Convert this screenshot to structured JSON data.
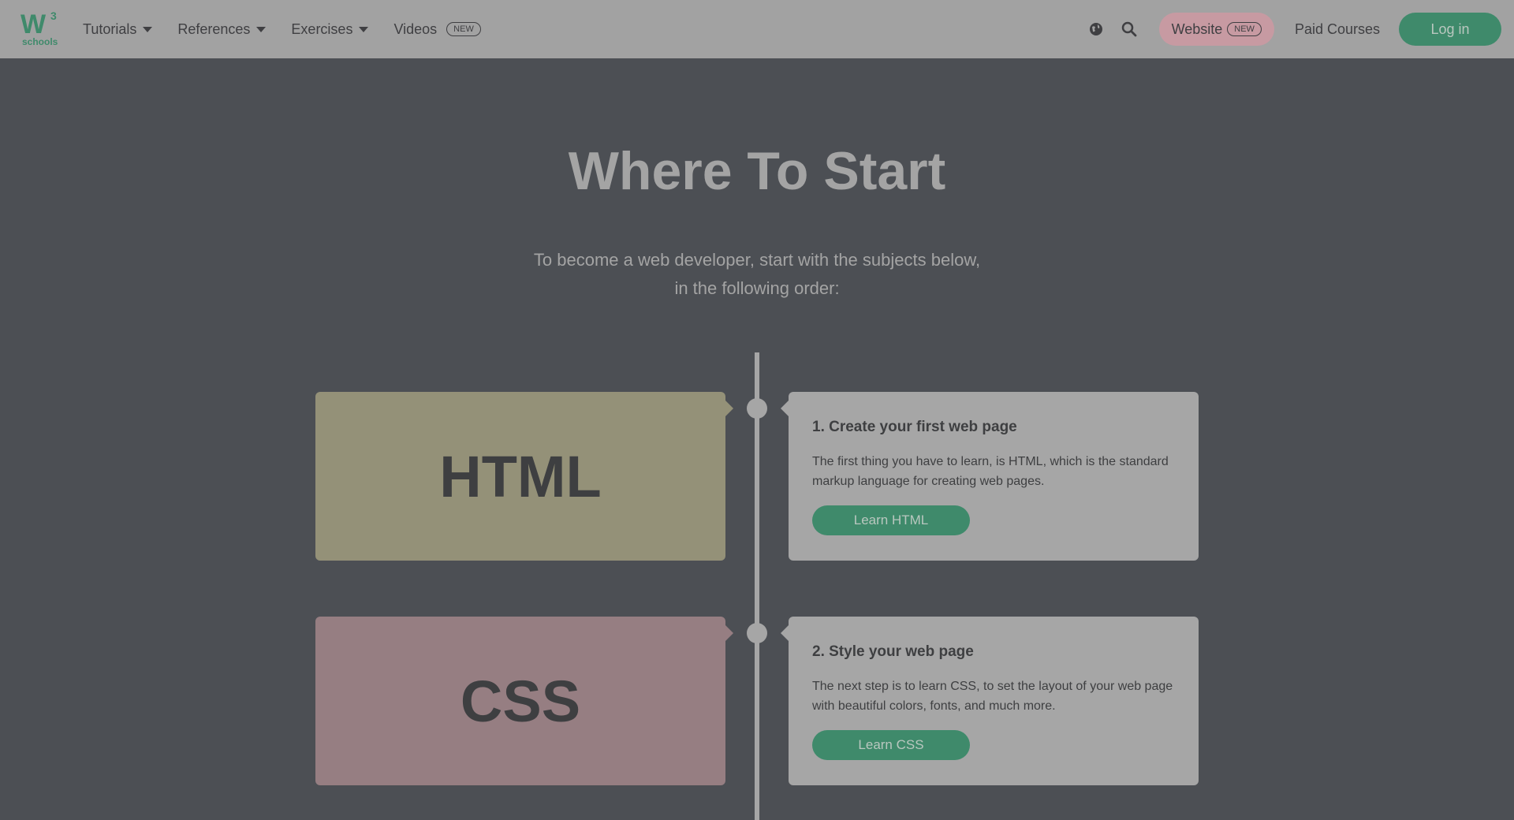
{
  "logo": {
    "mark": "W",
    "sup": "3",
    "word": "schools"
  },
  "nav": {
    "tutorials": "Tutorials",
    "references": "References",
    "exercises": "Exercises",
    "videos": "Videos",
    "videos_badge": "NEW"
  },
  "right_nav": {
    "globe_icon": "globe-icon",
    "search_icon": "search-icon",
    "website": "Website",
    "website_badge": "NEW",
    "paid_courses": "Paid Courses",
    "login": "Log in"
  },
  "hero": {
    "title": "Where To Start",
    "subtitle_line1": "To become a web developer, start with the subjects below,",
    "subtitle_line2": "in the following order:"
  },
  "steps": [
    {
      "card_label": "HTML",
      "card_color": "#949178",
      "heading": "1. Create your first web page",
      "text": "The first thing you have to learn, is HTML, which is the standard markup language for creating web pages.",
      "button": "Learn HTML"
    },
    {
      "card_label": "CSS",
      "card_color": "#967e82",
      "heading": "2. Style your web page",
      "text": "The next step is to learn CSS, to set the layout of your web page with beautiful colors, fonts, and much more.",
      "button": "Learn CSS"
    }
  ],
  "colors": {
    "page_bg": "#4c4f54",
    "topbar_bg": "#a2a2a2",
    "accent_green": "#3f8a6b",
    "website_pill": "#c79aa2"
  }
}
